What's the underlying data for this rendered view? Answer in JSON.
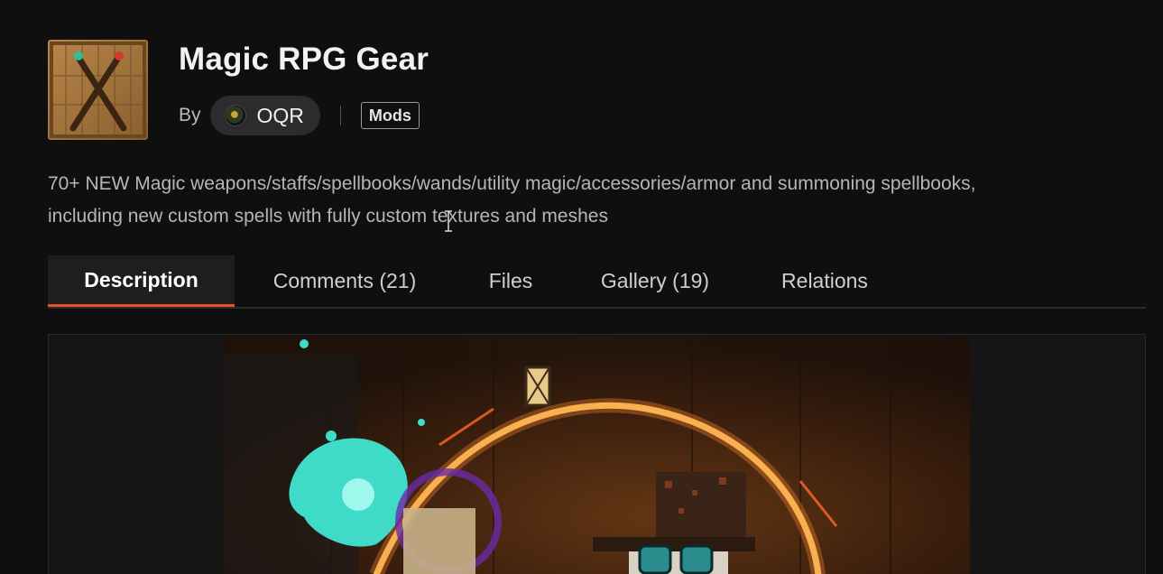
{
  "mod": {
    "title": "Magic RPG Gear",
    "by_label": "By",
    "author": "OQR",
    "category_tag": "Mods",
    "summary_line1": "70+ NEW Magic weapons/staffs/spellbooks/wands/utility magic/accessories/armor and summoning spellbooks,",
    "summary_line2": "including new custom spells with fully custom textures and meshes"
  },
  "tabs": [
    {
      "label": "Description",
      "active": true
    },
    {
      "label": "Comments (21)",
      "active": false
    },
    {
      "label": "Files",
      "active": false
    },
    {
      "label": "Gallery (19)",
      "active": false
    },
    {
      "label": "Relations",
      "active": false
    }
  ],
  "colors": {
    "background": "#0f0f10",
    "accent": "#e3502a",
    "pill": "#2c2c2e"
  },
  "icons": {
    "thumbnail": "crossed-staves-icon",
    "avatar": "author-avatar"
  }
}
